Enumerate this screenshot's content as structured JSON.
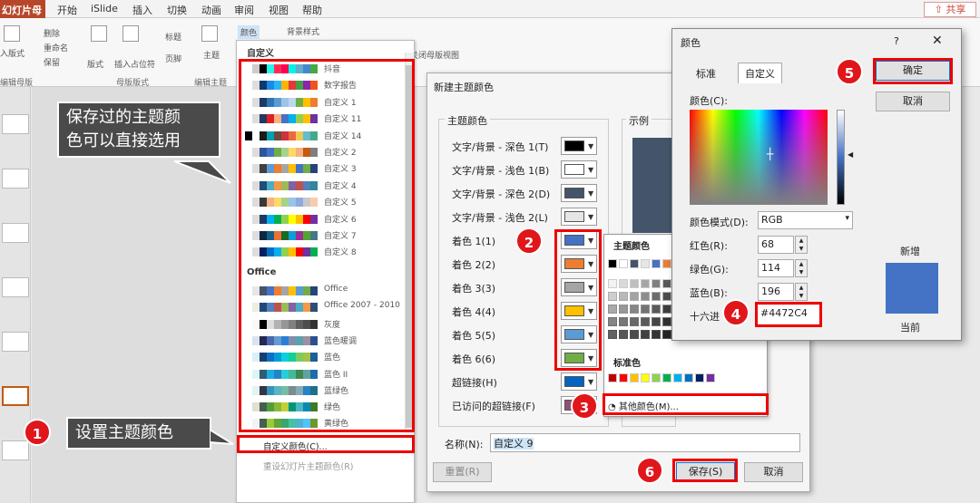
{
  "ribbon": {
    "file_tab": "幻灯片母版",
    "tabs": [
      "开始",
      "iSlide",
      "插入",
      "切换",
      "动画",
      "审阅",
      "视图",
      "帮助"
    ],
    "share": "共享",
    "buttons": [
      "入版式",
      "删除",
      "重命名",
      "保留",
      "版式",
      "插入占位符",
      "标题",
      "页脚",
      "主题",
      "颜色",
      "背景样式"
    ],
    "groups": [
      "编辑母版",
      "母版版式",
      "编辑主题"
    ],
    "close_view": "关闭母版视图"
  },
  "dropdown": {
    "custom_header": "自定义",
    "custom_themes": [
      {
        "name": "抖音",
        "colors": [
          "#ffffff",
          "#cccccc",
          "#000000",
          "#25f4ee",
          "#fe2c55",
          "#ff0050",
          "#00f2ea",
          "#6ac",
          "#48c",
          "#4a4"
        ]
      },
      {
        "name": "数字报告",
        "colors": [
          "#ffffff",
          "#ddd",
          "#0b3b6e",
          "#1e88e5",
          "#29b6f6",
          "#ffb300",
          "#e53935",
          "#43a047",
          "#8e24aa",
          "#f4511e"
        ]
      },
      {
        "name": "自定义 1",
        "colors": [
          "#ffffff",
          "#ddd",
          "#1f3864",
          "#2e75b6",
          "#5b9bd5",
          "#9dc3e6",
          "#bdd7ee",
          "#70ad47",
          "#ffc000",
          "#ed7d31"
        ]
      },
      {
        "name": "自定义 11",
        "colors": [
          "#ffffff",
          "#ddd",
          "#203864",
          "#e02020",
          "#f4b183",
          "#4472c4",
          "#00b0f0",
          "#92d050",
          "#ffc000",
          "#7030a0"
        ]
      },
      {
        "name": "自定义 14",
        "colors": [
          "#000000",
          "#ffffff",
          "#1a1a1a",
          "#00a0b0",
          "#6a4a3c",
          "#cc333f",
          "#eb6841",
          "#edc951",
          "#6bc",
          "#4a8"
        ]
      },
      {
        "name": "自定义 2",
        "colors": [
          "#ffffff",
          "#ddd",
          "#2f5597",
          "#4472c4",
          "#70ad47",
          "#a9d18e",
          "#ffd966",
          "#f4b183",
          "#c55a11",
          "#7f7f7f"
        ]
      },
      {
        "name": "自定义 3",
        "colors": [
          "#ffffff",
          "#ddd",
          "#404040",
          "#5b9bd5",
          "#ed7d31",
          "#a5a5a5",
          "#ffc000",
          "#4472c4",
          "#70ad47",
          "#264478"
        ]
      },
      {
        "name": "自定义 4",
        "colors": [
          "#ffffff",
          "#ddd",
          "#1f4e79",
          "#4bacc6",
          "#f79646",
          "#9bbb59",
          "#8064a2",
          "#c0504d",
          "#4f81bd",
          "#31859c"
        ]
      },
      {
        "name": "自定义 5",
        "colors": [
          "#ffffff",
          "#ddd",
          "#3b3838",
          "#f4b183",
          "#ffd966",
          "#a9d18e",
          "#9dc3e6",
          "#8faadc",
          "#c9c9c9",
          "#f8cbad"
        ]
      },
      {
        "name": "自定义 6",
        "colors": [
          "#ffffff",
          "#ddd",
          "#1f3864",
          "#00b0f0",
          "#00b050",
          "#92d050",
          "#ffff00",
          "#ffc000",
          "#ff0000",
          "#7030a0"
        ]
      },
      {
        "name": "自定义 7",
        "colors": [
          "#ffffff",
          "#ddd",
          "#0e2841",
          "#156082",
          "#e97132",
          "#196b24",
          "#0f9ed5",
          "#a02b93",
          "#4ea72e",
          "#467886"
        ]
      },
      {
        "name": "自定义 8",
        "colors": [
          "#ffffff",
          "#ddd",
          "#002060",
          "#0070c0",
          "#00b0f0",
          "#92d050",
          "#ffc000",
          "#ff0000",
          "#7030a0",
          "#00b050"
        ]
      }
    ],
    "office_header": "Office",
    "office_themes": [
      {
        "name": "Office",
        "colors": [
          "#ffffff",
          "#e7e6e6",
          "#44546a",
          "#4472c4",
          "#ed7d31",
          "#a5a5a5",
          "#ffc000",
          "#5b9bd5",
          "#70ad47",
          "#264478"
        ]
      },
      {
        "name": "Office 2007 - 2010",
        "colors": [
          "#ffffff",
          "#eeece1",
          "#1f497d",
          "#4f81bd",
          "#c0504d",
          "#9bbb59",
          "#8064a2",
          "#4bacc6",
          "#f79646",
          "#2c4d75"
        ]
      },
      {
        "name": "灰度",
        "colors": [
          "#ffffff",
          "#f8f8f8",
          "#000000",
          "#dddddd",
          "#b2b2b2",
          "#969696",
          "#808080",
          "#5f5f5f",
          "#4d4d4d",
          "#333333"
        ]
      },
      {
        "name": "蓝色暖调",
        "colors": [
          "#ffffff",
          "#dbe3ef",
          "#242852",
          "#4a66ac",
          "#629dd1",
          "#297fd5",
          "#7f8fa9",
          "#5aa2ae",
          "#9d90a0",
          "#2d4f8e"
        ]
      },
      {
        "name": "蓝色",
        "colors": [
          "#ffffff",
          "#dbeff9",
          "#17406d",
          "#0f6fc6",
          "#009dd9",
          "#0bd0d9",
          "#10cf9b",
          "#7cca62",
          "#a5c249",
          "#1b5e9c"
        ]
      },
      {
        "name": "蓝色 II",
        "colors": [
          "#ffffff",
          "#dbf5f9",
          "#335b74",
          "#1cade4",
          "#2683c6",
          "#27ced7",
          "#42ba97",
          "#3e8853",
          "#62a39f",
          "#1b6eab"
        ]
      },
      {
        "name": "蓝绿色",
        "colors": [
          "#ffffff",
          "#e2f3f4",
          "#373545",
          "#3494ba",
          "#58b6c0",
          "#75bda7",
          "#7a8c8e",
          "#84acb6",
          "#2683c6",
          "#1f6f8b"
        ]
      },
      {
        "name": "绿色",
        "colors": [
          "#ffffff",
          "#e3ded1",
          "#455f51",
          "#549e39",
          "#8ab833",
          "#c0cf3a",
          "#029676",
          "#4ab5c4",
          "#0989b1",
          "#3d7a28"
        ]
      },
      {
        "name": "黄绿色",
        "colors": [
          "#ffffff",
          "#f2f2f2",
          "#455f51",
          "#99cb38",
          "#63a537",
          "#37a76f",
          "#44c1a3",
          "#4eb3cf",
          "#51c3f9",
          "#6b9a2a"
        ]
      }
    ],
    "customize_colors": "自定义颜色(C)...",
    "reset_colors": "重设幻灯片主题颜色(R)"
  },
  "theme_dialog": {
    "title": "新建主题颜色",
    "group_label": "主题颜色",
    "sample_label": "示例",
    "rows": [
      {
        "label": "文字/背景 - 深色 1(T)",
        "color": "#000000"
      },
      {
        "label": "文字/背景 - 浅色 1(B)",
        "color": "#ffffff"
      },
      {
        "label": "文字/背景 - 深色 2(D)",
        "color": "#44546a"
      },
      {
        "label": "文字/背景 - 浅色 2(L)",
        "color": "#e7e6e6"
      },
      {
        "label": "着色 1(1)",
        "color": "#4472c4"
      },
      {
        "label": "着色 2(2)",
        "color": "#ed7d31"
      },
      {
        "label": "着色 3(3)",
        "color": "#a5a5a5"
      },
      {
        "label": "着色 4(4)",
        "color": "#ffc000"
      },
      {
        "label": "着色 5(5)",
        "color": "#5b9bd5"
      },
      {
        "label": "着色 6(6)",
        "color": "#70ad47"
      },
      {
        "label": "超链接(H)",
        "color": "#0563c1"
      },
      {
        "label": "已访问的超链接(F)",
        "color": "#954f72"
      }
    ],
    "name_label": "名称(N):",
    "name_value": "自定义 9",
    "reset_button": "重置(R)",
    "save_button": "保存(S)",
    "cancel_button": "取消"
  },
  "color_popup": {
    "theme_header": "主题颜色",
    "theme_colors": [
      "#000000",
      "#ffffff",
      "#44546a",
      "#e7e6e6",
      "#4472c4",
      "#ed7d31"
    ],
    "shade_colors": [
      "#f2f2f2",
      "#d9d9d9",
      "#bfbfbf",
      "#a6a6a6",
      "#808080",
      "#595959",
      "#d6dce5",
      "#deebf7"
    ],
    "standard_header": "标准色",
    "standard_colors": [
      "#c00000",
      "#ff0000",
      "#ffc000",
      "#ffff00",
      "#92d050",
      "#00b050",
      "#00b0f0",
      "#0070c0",
      "#002060",
      "#7030a0"
    ],
    "more_colors": "其他颜色(M)..."
  },
  "color_dialog": {
    "title": "颜色",
    "help": "?",
    "tabs": [
      "标准",
      "自定义"
    ],
    "colors_label": "颜色(C):",
    "mode_label": "颜色模式(D):",
    "mode_value": "RGB",
    "red_label": "红色(R):",
    "red": "68",
    "green_label": "绿色(G):",
    "green": "114",
    "blue_label": "蓝色(B):",
    "blue": "196",
    "hex_label": "十六进",
    "hex": "#4472C4",
    "ok": "确定",
    "cancel": "取消",
    "new_label": "新增",
    "current_label": "当前",
    "new_color": "#4472c4"
  },
  "annotations": {
    "callout_saved": [
      "保存过的主题颜",
      "色可以直接选用"
    ],
    "callout_set": "设置主题颜色",
    "badges": [
      "1",
      "2",
      "3",
      "4",
      "5",
      "6"
    ],
    "accent": "#e0161b"
  }
}
